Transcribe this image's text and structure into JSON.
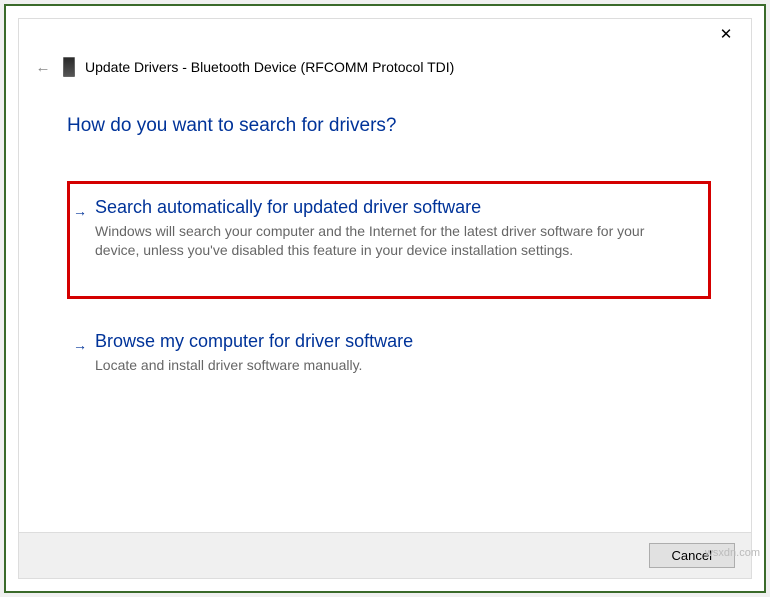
{
  "window": {
    "title": "Update Drivers - Bluetooth Device (RFCOMM Protocol TDI)"
  },
  "main": {
    "heading": "How do you want to search for drivers?",
    "options": [
      {
        "title": "Search automatically for updated driver software",
        "desc": "Windows will search your computer and the Internet for the latest driver software for your device, unless you've disabled this feature in your device installation settings.",
        "highlighted": true
      },
      {
        "title": "Browse my computer for driver software",
        "desc": "Locate and install driver software manually.",
        "highlighted": false
      }
    ]
  },
  "footer": {
    "cancel": "Cancel"
  },
  "watermark": "wsxdn.com"
}
